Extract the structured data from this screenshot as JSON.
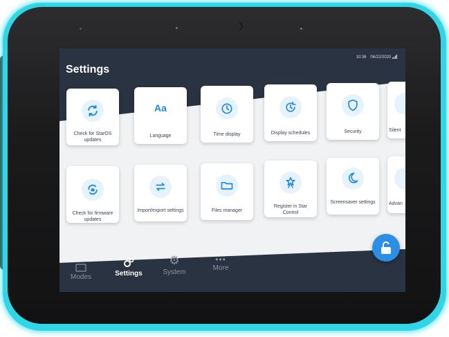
{
  "device": {
    "accent_color": "#30d6e6"
  },
  "status": {
    "time": "10:36",
    "date": "06/22/2020",
    "icon": "signal-icon"
  },
  "screen": {
    "title": "Settings"
  },
  "settings_row1": [
    {
      "label": "Check for StarOS updates",
      "icon": "refresh-icon"
    },
    {
      "label": "Language",
      "icon": "language-icon",
      "glyph": "Aa"
    },
    {
      "label": "Time display",
      "icon": "clock-icon"
    },
    {
      "label": "Display schedules",
      "icon": "schedule-icon"
    },
    {
      "label": "Security",
      "icon": "shield-icon"
    },
    {
      "label": "Silent",
      "icon": "silent-icon"
    }
  ],
  "settings_row2": [
    {
      "label": "Check for firmware updates",
      "icon": "firmware-update-icon"
    },
    {
      "label": "Import/export settings",
      "icon": "swap-icon"
    },
    {
      "label": "Files manager",
      "icon": "folder-icon"
    },
    {
      "label": "Register in Star Control",
      "icon": "star-tower-icon"
    },
    {
      "label": "Screensaver settings",
      "icon": "moon-icon"
    },
    {
      "label": "Advan",
      "icon": "advanced-icon"
    }
  ],
  "nav": {
    "items": [
      {
        "label": "Modes",
        "icon": "modes-icon"
      },
      {
        "label": "Settings",
        "icon": "gears-icon",
        "active": true
      },
      {
        "label": "System",
        "icon": "gear-icon"
      },
      {
        "label": "More",
        "icon": "more-dots-icon"
      }
    ]
  },
  "lock_button": {
    "icon": "unlock-icon",
    "color": "#2c8fe6"
  }
}
